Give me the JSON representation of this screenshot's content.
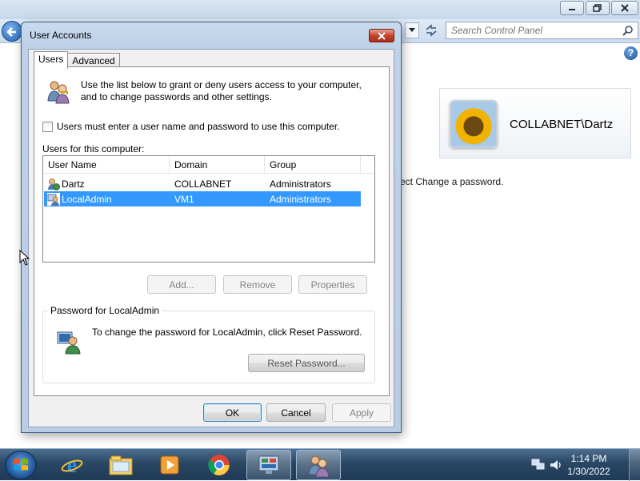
{
  "background_window": {
    "search_placeholder": "Search Control Panel",
    "account_name": "COLLABNET\\Dartz",
    "hint_text": "ect Change a password.",
    "help_symbol": "?"
  },
  "dialog": {
    "title": "User Accounts",
    "tabs": [
      {
        "label": "Users",
        "active": true
      },
      {
        "label": "Advanced",
        "active": false
      }
    ],
    "intro_text": "Use the list below to grant or deny users access to your computer, and to change passwords and other settings.",
    "checkbox_label": "Users must enter a user name and password to use this computer.",
    "checkbox_checked": false,
    "users_label": "Users for this computer:",
    "columns": [
      "User Name",
      "Domain",
      "Group"
    ],
    "users": [
      {
        "name": "Dartz",
        "domain": "COLLABNET",
        "group": "Administrators",
        "selected": false
      },
      {
        "name": "LocalAdmin",
        "domain": "VM1",
        "group": "Administrators",
        "selected": true
      }
    ],
    "buttons": {
      "add": "Add...",
      "remove": "Remove",
      "properties": "Properties",
      "reset_password": "Reset Password...",
      "ok": "OK",
      "cancel": "Cancel",
      "apply": "Apply"
    },
    "password_group": {
      "legend": "Password for LocalAdmin",
      "text": "To change the password for LocalAdmin, click Reset Password."
    }
  },
  "taskbar": {
    "time": "1:14 PM",
    "date": "1/30/2022",
    "items": [
      "start-orb",
      "internet-explorer",
      "file-explorer",
      "media-player",
      "chrome",
      "control-panel",
      "user-accounts"
    ]
  },
  "colors": {
    "selection": "#3399ff",
    "dialog_frame": "#bed1e8",
    "close_button": "#c4432d",
    "taskbar": "#2a4764"
  }
}
